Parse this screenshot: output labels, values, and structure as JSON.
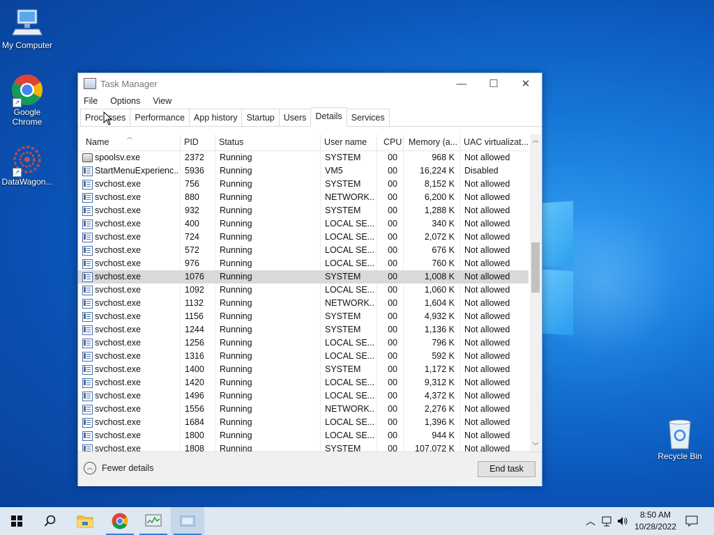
{
  "desktop": {
    "icons": [
      {
        "label": "My Computer"
      },
      {
        "label": "Google Chrome"
      },
      {
        "label": "DataWagon..."
      },
      {
        "label": "Recycle Bin"
      }
    ]
  },
  "window": {
    "title": "Task Manager",
    "menu": [
      "File",
      "Options",
      "View"
    ],
    "tabs": [
      "Processes",
      "Performance",
      "App history",
      "Startup",
      "Users",
      "Details",
      "Services"
    ],
    "active_tab": "Details",
    "columns": [
      "Name",
      "PID",
      "Status",
      "User name",
      "CPU",
      "Memory (a...",
      "UAC virtualizat..."
    ],
    "rows": [
      {
        "name": "spoolsv.exe",
        "pid": "2372",
        "status": "Running",
        "user": "SYSTEM",
        "cpu": "00",
        "mem": "968 K",
        "uac": "Not allowed"
      },
      {
        "name": "StartMenuExperienc...",
        "pid": "5936",
        "status": "Running",
        "user": "VM5",
        "cpu": "00",
        "mem": "16,224 K",
        "uac": "Disabled"
      },
      {
        "name": "svchost.exe",
        "pid": "756",
        "status": "Running",
        "user": "SYSTEM",
        "cpu": "00",
        "mem": "8,152 K",
        "uac": "Not allowed"
      },
      {
        "name": "svchost.exe",
        "pid": "880",
        "status": "Running",
        "user": "NETWORK...",
        "cpu": "00",
        "mem": "6,200 K",
        "uac": "Not allowed"
      },
      {
        "name": "svchost.exe",
        "pid": "932",
        "status": "Running",
        "user": "SYSTEM",
        "cpu": "00",
        "mem": "1,288 K",
        "uac": "Not allowed"
      },
      {
        "name": "svchost.exe",
        "pid": "400",
        "status": "Running",
        "user": "LOCAL SE...",
        "cpu": "00",
        "mem": "340 K",
        "uac": "Not allowed"
      },
      {
        "name": "svchost.exe",
        "pid": "724",
        "status": "Running",
        "user": "LOCAL SE...",
        "cpu": "00",
        "mem": "2,072 K",
        "uac": "Not allowed"
      },
      {
        "name": "svchost.exe",
        "pid": "572",
        "status": "Running",
        "user": "LOCAL SE...",
        "cpu": "00",
        "mem": "676 K",
        "uac": "Not allowed"
      },
      {
        "name": "svchost.exe",
        "pid": "976",
        "status": "Running",
        "user": "LOCAL SE...",
        "cpu": "00",
        "mem": "760 K",
        "uac": "Not allowed"
      },
      {
        "name": "svchost.exe",
        "pid": "1076",
        "status": "Running",
        "user": "SYSTEM",
        "cpu": "00",
        "mem": "1,008 K",
        "uac": "Not allowed"
      },
      {
        "name": "svchost.exe",
        "pid": "1092",
        "status": "Running",
        "user": "LOCAL SE...",
        "cpu": "00",
        "mem": "1,060 K",
        "uac": "Not allowed"
      },
      {
        "name": "svchost.exe",
        "pid": "1132",
        "status": "Running",
        "user": "NETWORK...",
        "cpu": "00",
        "mem": "1,604 K",
        "uac": "Not allowed"
      },
      {
        "name": "svchost.exe",
        "pid": "1156",
        "status": "Running",
        "user": "SYSTEM",
        "cpu": "00",
        "mem": "4,932 K",
        "uac": "Not allowed"
      },
      {
        "name": "svchost.exe",
        "pid": "1244",
        "status": "Running",
        "user": "SYSTEM",
        "cpu": "00",
        "mem": "1,136 K",
        "uac": "Not allowed"
      },
      {
        "name": "svchost.exe",
        "pid": "1256",
        "status": "Running",
        "user": "LOCAL SE...",
        "cpu": "00",
        "mem": "796 K",
        "uac": "Not allowed"
      },
      {
        "name": "svchost.exe",
        "pid": "1316",
        "status": "Running",
        "user": "LOCAL SE...",
        "cpu": "00",
        "mem": "592 K",
        "uac": "Not allowed"
      },
      {
        "name": "svchost.exe",
        "pid": "1400",
        "status": "Running",
        "user": "SYSTEM",
        "cpu": "00",
        "mem": "1,172 K",
        "uac": "Not allowed"
      },
      {
        "name": "svchost.exe",
        "pid": "1420",
        "status": "Running",
        "user": "LOCAL SE...",
        "cpu": "00",
        "mem": "9,312 K",
        "uac": "Not allowed"
      },
      {
        "name": "svchost.exe",
        "pid": "1496",
        "status": "Running",
        "user": "LOCAL SE...",
        "cpu": "00",
        "mem": "4,372 K",
        "uac": "Not allowed"
      },
      {
        "name": "svchost.exe",
        "pid": "1556",
        "status": "Running",
        "user": "NETWORK...",
        "cpu": "00",
        "mem": "2,276 K",
        "uac": "Not allowed"
      },
      {
        "name": "svchost.exe",
        "pid": "1684",
        "status": "Running",
        "user": "LOCAL SE...",
        "cpu": "00",
        "mem": "1,396 K",
        "uac": "Not allowed"
      },
      {
        "name": "svchost.exe",
        "pid": "1800",
        "status": "Running",
        "user": "LOCAL SE...",
        "cpu": "00",
        "mem": "944 K",
        "uac": "Not allowed"
      },
      {
        "name": "svchost.exe",
        "pid": "1808",
        "status": "Running",
        "user": "SYSTEM",
        "cpu": "00",
        "mem": "107,072 K",
        "uac": "Not allowed"
      }
    ],
    "selected_pid": "1076",
    "fewer_details": "Fewer details",
    "end_task": "End task"
  },
  "taskbar": {
    "time": "8:50 AM",
    "date": "10/28/2022"
  },
  "colors": {
    "accent": "#3a7bd5",
    "selection": "#d9d9d9",
    "desktop": "#0b54b8"
  }
}
